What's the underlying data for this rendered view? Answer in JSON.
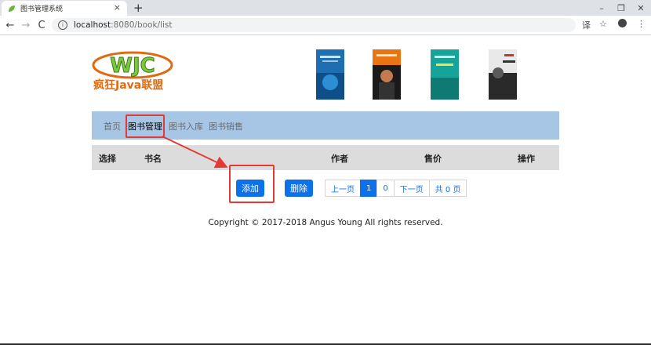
{
  "browser": {
    "tab_title": "图书管理系统",
    "tab_close": "×",
    "new_tab": "+",
    "url_host": "localhost",
    "url_path": ":8080/book/list",
    "minimize": "–",
    "restore": "❐",
    "close": "✕",
    "back": "←",
    "forward": "→",
    "reload": "C",
    "translate": "译",
    "bookmark": "☆",
    "menu": "⋮"
  },
  "header": {
    "logo_text": "疯狂Java联盟",
    "logo_letters": "WJC"
  },
  "nav": {
    "items": [
      "首页",
      "图书管理",
      "图书入库",
      "图书销售"
    ]
  },
  "table": {
    "headers": [
      "选择",
      "书名",
      "作者",
      "售价",
      "操作"
    ]
  },
  "actions": {
    "add": "添加",
    "delete": "删除"
  },
  "pagination": {
    "prev": "上一页",
    "current": "1",
    "page_zero": "0",
    "next": "下一页",
    "total": "共 0 页"
  },
  "footer": {
    "copyright": "Copyright © 2017-2018 Angus Young All rights reserved."
  },
  "colors": {
    "nav_bg": "#a7c5e4",
    "primary": "#0d72ea",
    "annotation_red": "#e53935"
  }
}
